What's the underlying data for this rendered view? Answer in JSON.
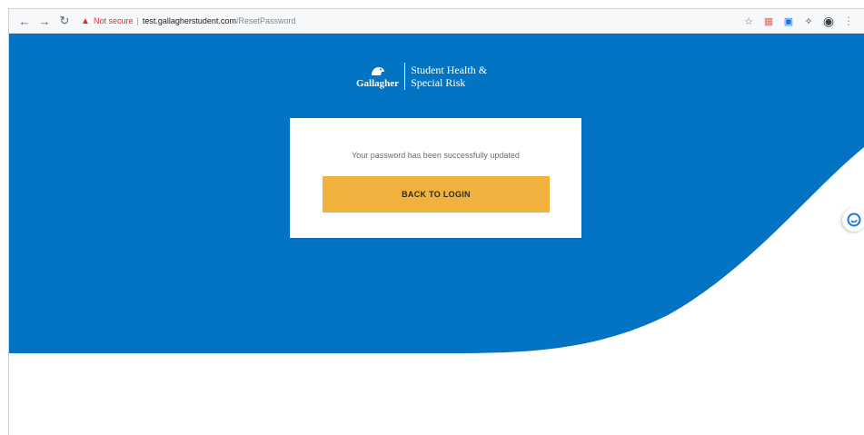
{
  "browser": {
    "security_label": "Not secure",
    "url_separator": "|",
    "url_host": "test.gallagherstudent.com",
    "url_path": "/ResetPassword",
    "icons": {
      "back": "arrow-left-icon",
      "forward": "arrow-right-icon",
      "reload": "reload-icon",
      "warning": "warning-triangle-icon",
      "star": "star-icon",
      "extensions": [
        "calendar-icon",
        "screen-icon",
        "puzzle-icon"
      ],
      "profile": "profile-icon",
      "menu": "kebab-menu-icon"
    }
  },
  "brand": {
    "name": "Gallagher",
    "tagline_line1": "Student Health &",
    "tagline_line2": "Special Risk"
  },
  "card": {
    "message": "Your password has been successfully updated",
    "button_label": "BACK TO LOGIN"
  },
  "colors": {
    "hero_blue": "#0373c4",
    "button_yellow": "#f0b23c",
    "page_bg": "#ffffff",
    "warning_red": "#d93025"
  }
}
